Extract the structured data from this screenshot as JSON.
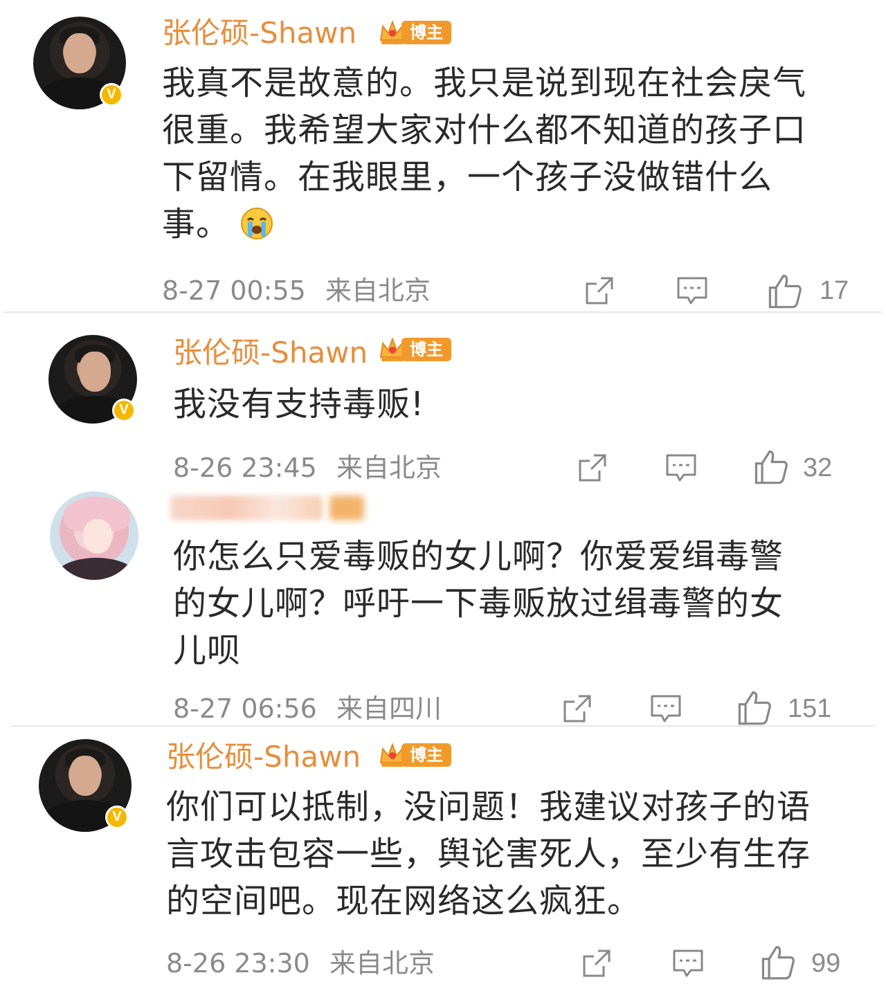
{
  "comments": [
    {
      "username": "张伦硕-Shawn",
      "badge": "博主",
      "verified": "V",
      "text": "我真不是故意的。我只是说到现在社会戾气很重。我希望大家对什么都不知道的孩子口下留情。在我眼里，一个孩子没做错什么事。",
      "emoji": "crying-face",
      "time": "8-27 00:55",
      "location": "来自北京",
      "likes": "17"
    },
    {
      "username": "张伦硕-Shawn",
      "badge": "博主",
      "verified": "V",
      "text": "我没有支持毒贩!",
      "time": "8-26 23:45",
      "location": "来自北京",
      "likes": "32"
    },
    {
      "username": "",
      "text": "你怎么只爱毒贩的女儿啊？你爱爱缉毒警的女儿啊？呼吁一下毒贩放过缉毒警的女儿呗",
      "time": "8-27 06:56",
      "location": "来自四川",
      "likes": "151"
    },
    {
      "username": "张伦硕-Shawn",
      "badge": "博主",
      "verified": "V",
      "text": "你们可以抵制，没问题！我建议对孩子的语言攻击包容一些，舆论害死人，至少有生存的空间吧。现在网络这么疯狂。",
      "time": "8-26 23:30",
      "location": "来自北京",
      "likes": "99"
    }
  ],
  "icons": {
    "share": "share-icon",
    "comment": "comment-icon",
    "like": "thumbs-up-icon",
    "crown": "crown-icon"
  },
  "colors": {
    "username": "#e78d3a",
    "badge": "#f19a2b",
    "verified": "#f5b800",
    "meta": "#8a8a8a",
    "text": "#2a2a2a"
  }
}
